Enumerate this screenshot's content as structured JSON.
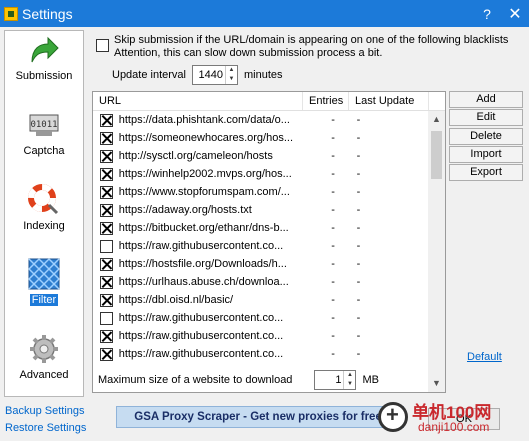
{
  "window": {
    "title": "Settings",
    "controls": [
      "?",
      "✕"
    ]
  },
  "nav": [
    {
      "label": "Submission",
      "icon": "green-arrow-icon",
      "selected": false
    },
    {
      "label": "Captcha",
      "icon": "captcha-icon",
      "selected": false
    },
    {
      "label": "Indexing",
      "icon": "lifebuoy-icon",
      "selected": false
    },
    {
      "label": "Filter",
      "icon": "filter-icon",
      "selected": true
    },
    {
      "label": "Advanced",
      "icon": "gear-icon",
      "selected": false
    }
  ],
  "skip": {
    "checked": false,
    "line1": "Skip submission if the URL/domain is appearing on one of the following blacklists",
    "line2": "Attention, this can slow down submission process a bit."
  },
  "interval": {
    "label": "Update interval",
    "value": "1440",
    "unit": "minutes"
  },
  "table": {
    "headers": {
      "url": "URL",
      "entries": "Entries",
      "last": "Last Update"
    },
    "rows": [
      {
        "checked": true,
        "url": "https://data.phishtank.com/data/o...",
        "entries": "-",
        "last": "-"
      },
      {
        "checked": true,
        "url": "https://someonewhocares.org/hos...",
        "entries": "-",
        "last": "-"
      },
      {
        "checked": true,
        "url": "http://sysctl.org/cameleon/hosts",
        "entries": "-",
        "last": "-"
      },
      {
        "checked": true,
        "url": "https://winhelp2002.mvps.org/hos...",
        "entries": "-",
        "last": "-"
      },
      {
        "checked": true,
        "url": "https://www.stopforumspam.com/...",
        "entries": "-",
        "last": "-"
      },
      {
        "checked": true,
        "url": "https://adaway.org/hosts.txt",
        "entries": "-",
        "last": "-"
      },
      {
        "checked": true,
        "url": "https://bitbucket.org/ethanr/dns-b...",
        "entries": "-",
        "last": "-"
      },
      {
        "checked": false,
        "url": "https://raw.githubusercontent.co...",
        "entries": "-",
        "last": "-"
      },
      {
        "checked": true,
        "url": "https://hostsfile.org/Downloads/h...",
        "entries": "-",
        "last": "-"
      },
      {
        "checked": true,
        "url": "https://urlhaus.abuse.ch/downloa...",
        "entries": "-",
        "last": "-"
      },
      {
        "checked": true,
        "url": "https://dbl.oisd.nl/basic/",
        "entries": "-",
        "last": "-"
      },
      {
        "checked": false,
        "url": "https://raw.githubusercontent.co...",
        "entries": "-",
        "last": "-"
      },
      {
        "checked": true,
        "url": "https://raw.githubusercontent.co...",
        "entries": "-",
        "last": "-"
      },
      {
        "checked": true,
        "url": "https://raw.githubusercontent.co...",
        "entries": "-",
        "last": "-"
      }
    ]
  },
  "buttons": {
    "add": "Add",
    "edit": "Edit",
    "delete": "Delete",
    "import": "Import",
    "export": "Export",
    "default": "Default",
    "ok": "OK"
  },
  "maxsize": {
    "label": "Maximum size of a website to download",
    "value": "1",
    "unit": "MB"
  },
  "banner": "GSA Proxy Scraper - Get new proxies for free!",
  "links": {
    "backup": "Backup Settings",
    "restore": "Restore Settings"
  },
  "watermark": {
    "line1": "单机100网",
    "line2": "danji100.com"
  }
}
